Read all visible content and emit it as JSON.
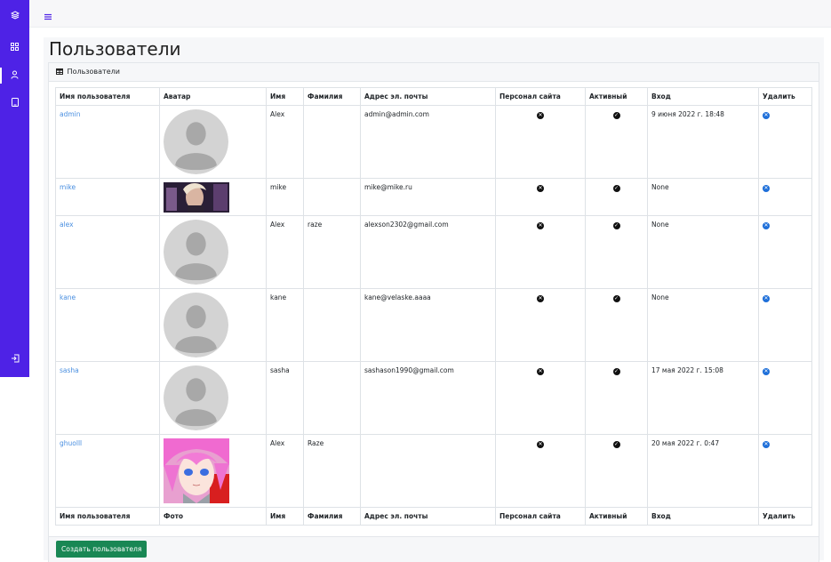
{
  "page": {
    "title": "Пользователи"
  },
  "card": {
    "header": "Пользователи",
    "create_button": "Создать пользователя"
  },
  "colors": {
    "sidebar": "#4e22e6",
    "link": "#4a8fe0",
    "delete": "#1e6fd9",
    "create_button": "#198754"
  },
  "sidebar": {
    "icons": [
      "layers-icon",
      "grid-icon",
      "user-icon",
      "tablet-icon",
      "logout-icon"
    ],
    "active": "user-icon"
  },
  "table": {
    "header": [
      "Имя пользователя",
      "Аватар",
      "Имя",
      "Фамилия",
      "Адрес эл. почты",
      "Персонал сайта",
      "Активный",
      "Вход",
      "Удалить"
    ],
    "footer": [
      "Имя пользователя",
      "Фото",
      "Имя",
      "Фамилия",
      "Адрес эл. почты",
      "Персонал сайта",
      "Активный",
      "Вход",
      "Удалить"
    ],
    "rows": [
      {
        "username": "admin",
        "avatar": "default-avatar",
        "first_name": "Alex",
        "last_name": "",
        "email": "admin@admin.com",
        "staff": "x",
        "active": "check",
        "login": "9 июня 2022 г. 18:48"
      },
      {
        "username": "mike",
        "avatar": "anime-banner",
        "first_name": "mike",
        "last_name": "",
        "email": "mike@mike.ru",
        "staff": "x",
        "active": "check",
        "login": "None"
      },
      {
        "username": "alex",
        "avatar": "default-avatar",
        "first_name": "Alex",
        "last_name": "raze",
        "email": "alexson2302@gmail.com",
        "staff": "x",
        "active": "check",
        "login": "None"
      },
      {
        "username": "kane",
        "avatar": "default-avatar",
        "first_name": "kane",
        "last_name": "",
        "email": "kane@velaske.aaaa",
        "staff": "x",
        "active": "check",
        "login": "None"
      },
      {
        "username": "sasha",
        "avatar": "default-avatar",
        "first_name": "sasha",
        "last_name": "",
        "email": "sashason1990@gmail.com",
        "staff": "x",
        "active": "check",
        "login": "17 мая 2022 г. 15:08"
      },
      {
        "username": "ghuolll",
        "avatar": "anime-portrait",
        "first_name": "Alex",
        "last_name": "Raze",
        "email": "",
        "staff": "x",
        "active": "check",
        "login": "20 мая 2022 г. 0:47"
      }
    ]
  }
}
